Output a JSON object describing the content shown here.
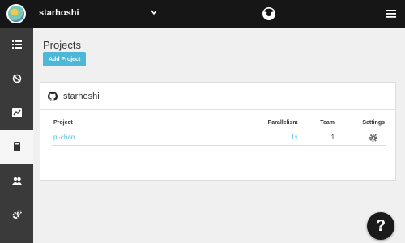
{
  "topbar": {
    "org_name": "starhoshi",
    "logo_icon": "circleci-logo-icon",
    "menu_icon": "hamburger-icon"
  },
  "sidebar": {
    "items": [
      {
        "icon": "builds-list-icon",
        "active": false
      },
      {
        "icon": "workflows-icon",
        "active": false
      },
      {
        "icon": "insights-icon",
        "active": false
      },
      {
        "icon": "projects-book-icon",
        "active": true
      },
      {
        "icon": "team-icon",
        "active": false
      },
      {
        "icon": "settings-gears-icon",
        "active": false
      }
    ]
  },
  "page": {
    "title": "Projects",
    "add_project_label": "Add Project"
  },
  "card": {
    "title": "starhoshi",
    "columns": [
      "Project",
      "Parallelism",
      "Team",
      "Settings"
    ],
    "rows": [
      {
        "project": "pi-chan",
        "parallelism": "1x",
        "team": "1",
        "settings_icon": "gear-icon"
      }
    ]
  },
  "help": {
    "label": "?"
  },
  "colors": {
    "topbar": "#161616",
    "sidebar": "#3a3a3a",
    "accent": "#4cb7d6"
  }
}
